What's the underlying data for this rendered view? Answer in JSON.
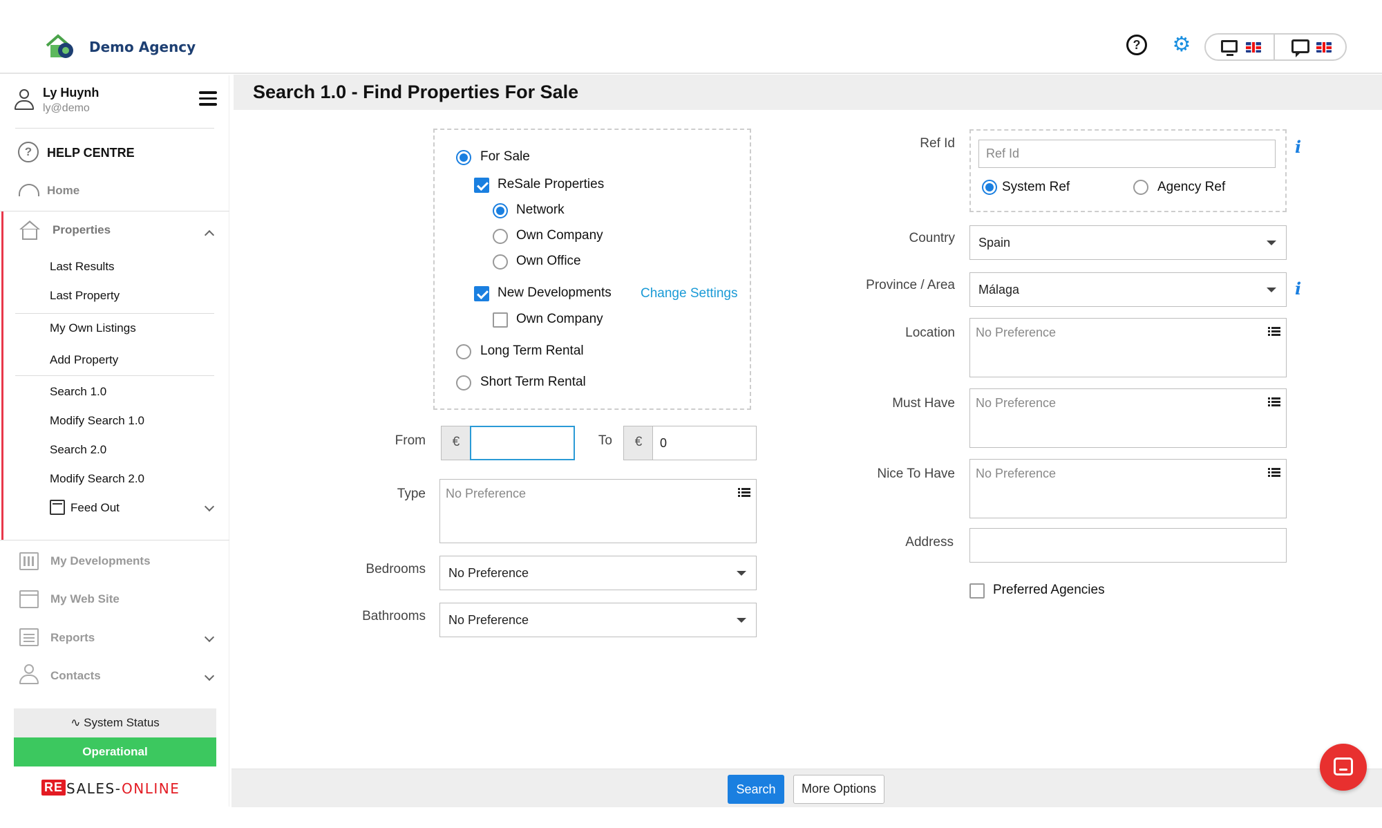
{
  "header": {
    "brand": "Demo Agency",
    "help_icon": "question-circle-icon",
    "settings_icon": "gear-icon",
    "view_switch_icon": "monitor-icon",
    "language_flag": "uk-flag-icon",
    "chat_icon": "chat-icon",
    "accent_color": "#1a7fe0"
  },
  "user": {
    "name": "Ly Huynh",
    "email": "ly@demo"
  },
  "sidebar": {
    "help_centre": "HELP CENTRE",
    "home": "Home",
    "properties": "Properties",
    "property_items": [
      "Last Results",
      "Last Property",
      "My Own Listings",
      "Add Property",
      "Search 1.0",
      "Modify Search 1.0",
      "Search 2.0",
      "Modify Search 2.0"
    ],
    "feed_out": "Feed Out",
    "sections": [
      "My Developments",
      "My Web Site",
      "Reports",
      "Contacts"
    ],
    "system_status_label": "System Status",
    "system_status_value": "Operational",
    "status_color": "#3cc85f",
    "footer_logo_re": "RE",
    "footer_logo_text": "SALES-",
    "footer_logo_text2": "ONLINE"
  },
  "page": {
    "title": "Search 1.0 - Find Properties For Sale"
  },
  "form": {
    "listing_type": {
      "for_sale": "For Sale",
      "resale": "ReSale Properties",
      "network": "Network",
      "own_company": "Own Company",
      "own_office": "Own Office",
      "new_developments": "New Developments",
      "change_settings": "Change Settings",
      "nd_own_company": "Own Company",
      "long_term": "Long Term Rental",
      "short_term": "Short Term Rental"
    },
    "from_label": "From",
    "to_label": "To",
    "currency": "€",
    "from_value": "",
    "to_value": "0",
    "type_label": "Type",
    "type_placeholder": "No Preference",
    "bedrooms_label": "Bedrooms",
    "bedrooms_value": "No Preference",
    "bathrooms_label": "Bathrooms",
    "bathrooms_value": "No Preference",
    "ref_id_label": "Ref Id",
    "ref_id_placeholder": "Ref Id",
    "system_ref": "System Ref",
    "agency_ref": "Agency Ref",
    "country_label": "Country",
    "country_value": "Spain",
    "province_label": "Province / Area",
    "province_value": "Málaga",
    "location_label": "Location",
    "location_placeholder": "No Preference",
    "must_have_label": "Must Have",
    "must_have_placeholder": "No Preference",
    "nice_to_have_label": "Nice To Have",
    "nice_to_have_placeholder": "No Preference",
    "address_label": "Address",
    "address_value": "",
    "preferred_agencies": "Preferred Agencies"
  },
  "footer": {
    "search_button": "Search",
    "more_options_button": "More Options"
  }
}
